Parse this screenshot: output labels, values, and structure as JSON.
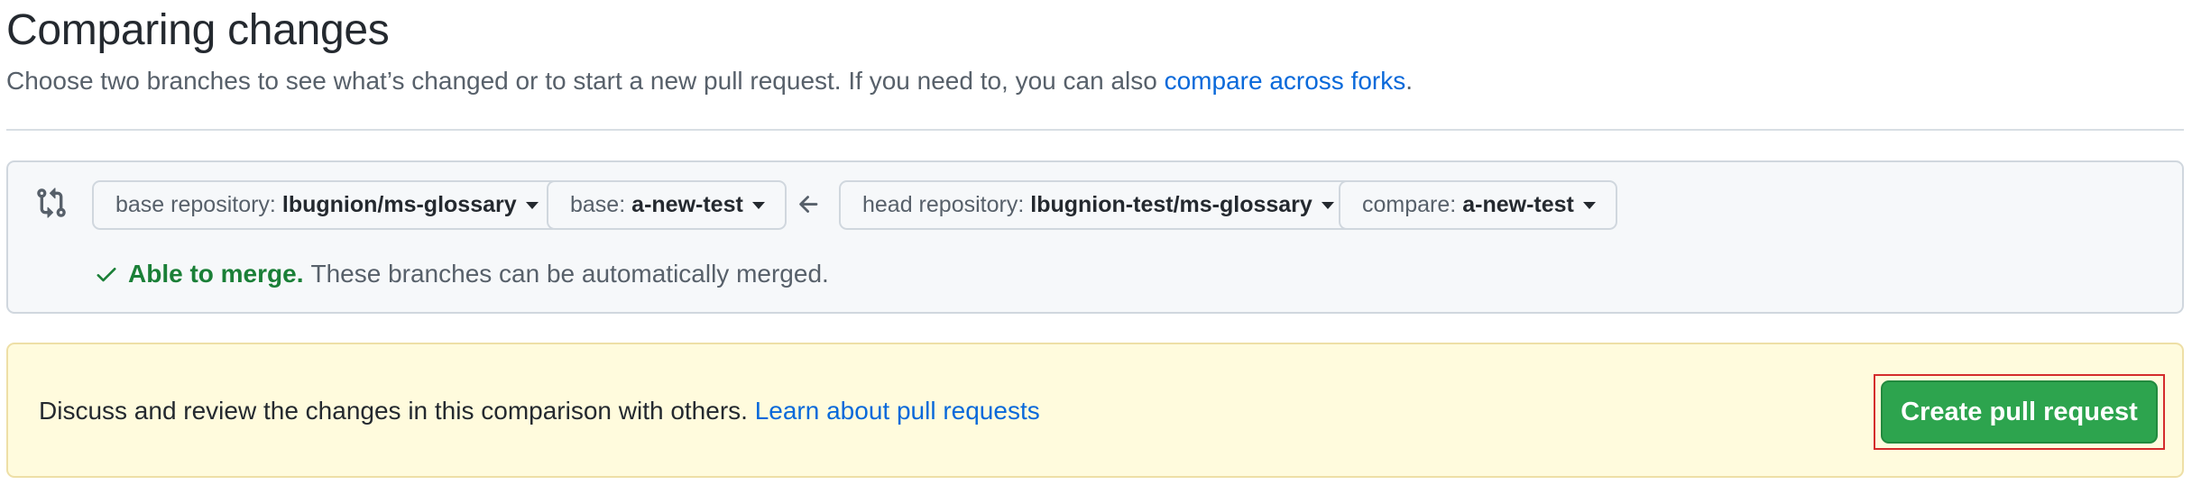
{
  "header": {
    "title": "Comparing changes",
    "subtitle_prefix": "Choose two branches to see what’s changed or to start a new pull request. If you need to, you can also ",
    "subtitle_link": "compare across forks",
    "subtitle_suffix": "."
  },
  "range": {
    "base_repo_label": "base repository:",
    "base_repo_value": "lbugnion/ms-glossary",
    "base_label": "base:",
    "base_value": "a-new-test",
    "head_repo_label": "head repository:",
    "head_repo_value": "lbugnion-test/ms-glossary",
    "compare_label": "compare:",
    "compare_value": "a-new-test",
    "merge_status": "Able to merge.",
    "merge_message": "These branches can be automatically merged."
  },
  "banner": {
    "text": "Discuss and review the changes in this comparison with others. ",
    "link": "Learn about pull requests",
    "button": "Create pull request"
  },
  "colors": {
    "link": "#0969da",
    "success": "#1a7f37",
    "button_bg": "#2da44e",
    "banner_bg": "#fffbdd",
    "highlight": "#d42c2c"
  }
}
